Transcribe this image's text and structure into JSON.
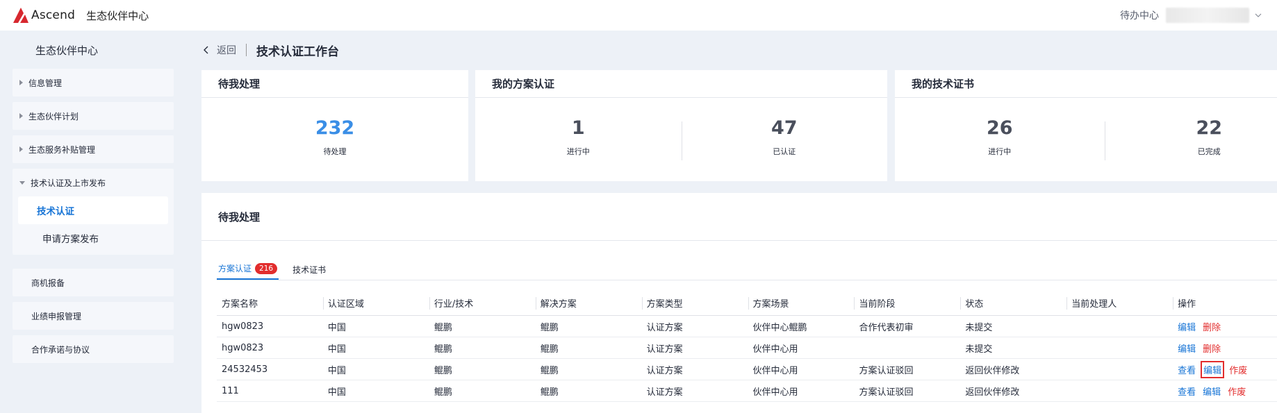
{
  "header": {
    "logo_text": "Ascend",
    "app_title": "生态伙伴中心",
    "todo_label": "待办中心"
  },
  "sidebar": {
    "title": "生态伙伴中心",
    "groups": [
      {
        "label": "信息管理"
      },
      {
        "label": "生态伙伴计划"
      },
      {
        "label": "生态服务补贴管理"
      },
      {
        "label": "技术认证及上市发布",
        "children": [
          "技术认证",
          "申请方案发布"
        ]
      },
      {
        "label": "商机报备"
      },
      {
        "label": "业绩申报管理"
      },
      {
        "label": "合作承诺与协议"
      }
    ]
  },
  "breadcrumb": {
    "back_label": "返回",
    "page_title": "技术认证工作台"
  },
  "cards": {
    "pending": {
      "title": "待我处理",
      "stats": [
        {
          "value": "232",
          "label": "待处理"
        }
      ]
    },
    "solutions": {
      "title": "我的方案认证",
      "stats": [
        {
          "value": "1",
          "label": "进行中"
        },
        {
          "value": "47",
          "label": "已认证"
        }
      ]
    },
    "certs": {
      "title": "我的技术证书",
      "stats": [
        {
          "value": "26",
          "label": "进行中"
        },
        {
          "value": "22",
          "label": "已完成"
        }
      ]
    }
  },
  "panel": {
    "title": "待我处理",
    "tabs": [
      {
        "label": "方案认证",
        "badge": "216"
      },
      {
        "label": "技术证书"
      }
    ],
    "columns": [
      "方案名称",
      "认证区域",
      "行业/技术",
      "解决方案",
      "方案类型",
      "方案场景",
      "当前阶段",
      "状态",
      "当前处理人",
      "操作"
    ],
    "rows": [
      {
        "cells": [
          "hgw0823",
          "中国",
          "鲲鹏",
          "鲲鹏",
          "认证方案",
          "伙伴中心鲲鹏",
          "合作代表初审",
          "未提交",
          ""
        ],
        "ops": [
          "编辑",
          "删除"
        ]
      },
      {
        "cells": [
          "hgw0823",
          "中国",
          "鲲鹏",
          "鲲鹏",
          "认证方案",
          "伙伴中心用",
          "",
          "未提交",
          ""
        ],
        "ops": [
          "编辑",
          "删除"
        ]
      },
      {
        "cells": [
          "24532453",
          "中国",
          "鲲鹏",
          "鲲鹏",
          "认证方案",
          "伙伴中心用",
          "方案认证驳回",
          "返回伙伴修改",
          ""
        ],
        "ops": [
          "查看",
          "编辑",
          "作废"
        ]
      },
      {
        "cells": [
          "111",
          "中国",
          "鲲鹏",
          "鲲鹏",
          "认证方案",
          "伙伴中心用",
          "方案认证驳回",
          "返回伙伴修改",
          ""
        ],
        "ops": [
          "查看",
          "编辑",
          "作废"
        ]
      }
    ]
  },
  "colors": {
    "accent": "#1875d6",
    "danger": "#e22d2d",
    "logo_red": "#d7282f"
  }
}
